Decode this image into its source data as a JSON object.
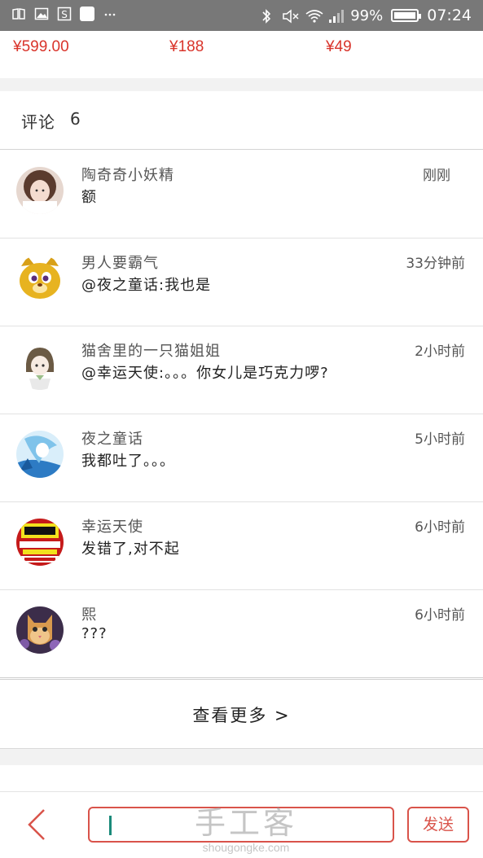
{
  "status_bar": {
    "battery": "99%",
    "time": "07:24",
    "battery_level": 0.99,
    "left_icons": [
      "reader-icon",
      "image-icon",
      "s-app-icon",
      "square-app-icon",
      "more-icon"
    ],
    "right_icons": [
      "bluetooth-icon",
      "mute-icon",
      "wifi-icon",
      "signal-icon"
    ]
  },
  "prices": [
    "¥599.00",
    "¥188",
    "¥49"
  ],
  "comments": {
    "title": "评论",
    "count": "6",
    "items": [
      {
        "name": "陶奇奇小妖精",
        "text": "额",
        "time": "刚刚"
      },
      {
        "name": "男人要霸气",
        "text": "@夜之童话:我也是",
        "time": "33分钟前"
      },
      {
        "name": "猫舍里的一只猫姐姐",
        "text": "@幸运天使:。。。你女儿是巧克力啰?",
        "time": "2小时前"
      },
      {
        "name": "夜之童话",
        "text": "我都吐了。。。",
        "time": "5小时前"
      },
      {
        "name": "幸运天使",
        "text": "发错了,对不起",
        "time": "6小时前"
      },
      {
        "name": "熙",
        "text": "???",
        "time": "6小时前"
      }
    ],
    "view_more": "查看更多 >"
  },
  "bottom_bar": {
    "input_value": "",
    "send_label": "发送"
  },
  "watermark": {
    "main": "手工客",
    "sub": "shougongke.com"
  },
  "colors": {
    "accent": "#d9534a",
    "price": "#d9342b",
    "status_bar_bg": "#787878"
  }
}
